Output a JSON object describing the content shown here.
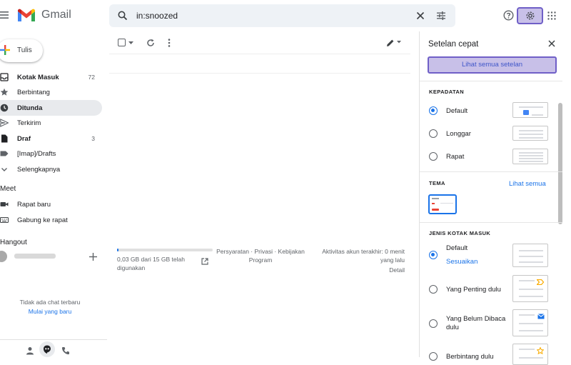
{
  "app": {
    "name": "Gmail"
  },
  "search": {
    "value": "in:snoozed"
  },
  "sidebar": {
    "compose_label": "Tulis",
    "items": [
      {
        "label": "Kotak Masuk",
        "count": "72",
        "bold": true
      },
      {
        "label": "Berbintang",
        "count": "",
        "bold": false
      },
      {
        "label": "Ditunda",
        "count": "",
        "bold": true
      },
      {
        "label": "Terkirim",
        "count": "",
        "bold": false
      },
      {
        "label": "Draf",
        "count": "3",
        "bold": true
      },
      {
        "label": "[Imap]/Drafts",
        "count": "",
        "bold": false
      },
      {
        "label": "Selengkapnya",
        "count": "",
        "bold": false
      }
    ],
    "meet_title": "Meet",
    "meet_items": [
      "Rapat baru",
      "Gabung ke rapat"
    ],
    "hangout_title": "Hangout",
    "no_chat_text": "Tidak ada chat terbaru",
    "start_new_link": "Mulai yang baru"
  },
  "footer": {
    "storage": "0,03 GB dari 15 GB telah digunakan",
    "storage_fraction": 0.002,
    "terms": "Persyaratan · Privasi · Kebijakan Program",
    "activity": "Aktivitas akun terakhir: 0 menit yang lalu",
    "details": "Detail"
  },
  "quick_settings": {
    "title": "Setelan cepat",
    "see_all_button": "Lihat semua setelan",
    "density": {
      "heading": "KEPADATAN",
      "options": [
        "Default",
        "Longgar",
        "Rapat"
      ],
      "selected": "Default"
    },
    "theme": {
      "heading": "TEMA",
      "see_all": "Lihat semua"
    },
    "inbox_type": {
      "heading": "JENIS KOTAK MASUK",
      "options": [
        "Default",
        "Yang Penting dulu",
        "Yang Belum Dibaca dulu",
        "Berbintang dulu"
      ],
      "customize": "Sesuaikan",
      "selected": "Default"
    }
  },
  "colors": {
    "accent": "#1a73e8",
    "highlight_fill": "#c8c0e8",
    "highlight_border": "#6f5fc7",
    "active_nav": "#e8eaed"
  }
}
